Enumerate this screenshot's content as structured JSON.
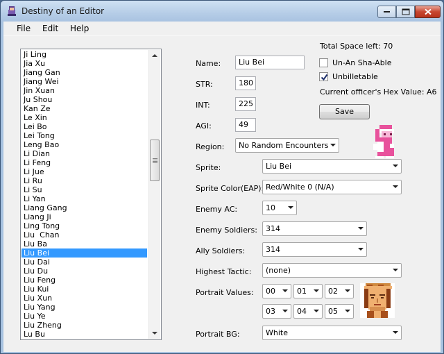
{
  "window": {
    "title": "Destiny of an Editor"
  },
  "menu": {
    "file": "File",
    "edit": "Edit",
    "help": "Help"
  },
  "officers": {
    "items": [
      "Ji Ling",
      "Jia Xu",
      "Jiang Gan",
      "Jiang Wei",
      "Jin Xuan",
      "Ju Shou",
      "Kan Ze",
      "Le Xin",
      "Lei Bo",
      "Lei Tong",
      "Leng Bao",
      "Li Dian",
      "Li Feng",
      "Li Jue",
      "Li Ru",
      "Li Su",
      "Li Yan",
      "Liang Gang",
      "Liang Ji",
      "Ling Tong",
      "Liu  Chan",
      "Liu Ba",
      "Liu Bei",
      "Liu Dai",
      "Liu Du",
      "Liu Feng",
      "Liu Kui",
      "Liu Xun",
      "Liu Yang",
      "Liu Ye",
      "Liu Zheng",
      "Lu Bu"
    ],
    "selected": "Liu Bei"
  },
  "form": {
    "name_label": "Name:",
    "name_value": "Liu Bei",
    "str_label": "STR:",
    "str_value": "180",
    "int_label": "INT:",
    "int_value": "225",
    "agi_label": "AGI:",
    "agi_value": "49",
    "region_label": "Region:",
    "region_value": "No Random Encounters",
    "sprite_label": "Sprite:",
    "sprite_value": "Liu Bei",
    "sprite_color_label": "Sprite Color(EAP):",
    "sprite_color_value": "Red/White 0 (N/A)",
    "enemy_ac_label": "Enemy AC:",
    "enemy_ac_value": "10",
    "enemy_soldiers_label": "Enemy Soldiers:",
    "enemy_soldiers_value": "314",
    "ally_soldiers_label": "Ally Soldiers:",
    "ally_soldiers_value": "314",
    "highest_tactic_label": "Highest Tactic:",
    "highest_tactic_value": "(none)",
    "portrait_values_label": "Portrait Values:",
    "portrait_values": [
      "00",
      "01",
      "02",
      "03",
      "04",
      "05"
    ],
    "portrait_bg_label": "Portrait BG:",
    "portrait_bg_value": "White"
  },
  "side": {
    "total_space": "Total Space left: 70",
    "unan_label": "Un-An Sha-Able",
    "unan_checked": false,
    "unbilletable_label": "Unbilletable",
    "unbilletable_checked": true,
    "hex_value": "Current officer's Hex Value: A6",
    "save_label": "Save"
  },
  "colors": {
    "selection": "#3399ff",
    "sprite_pink": "#e8529c",
    "portrait_skin": "#f0b070"
  }
}
